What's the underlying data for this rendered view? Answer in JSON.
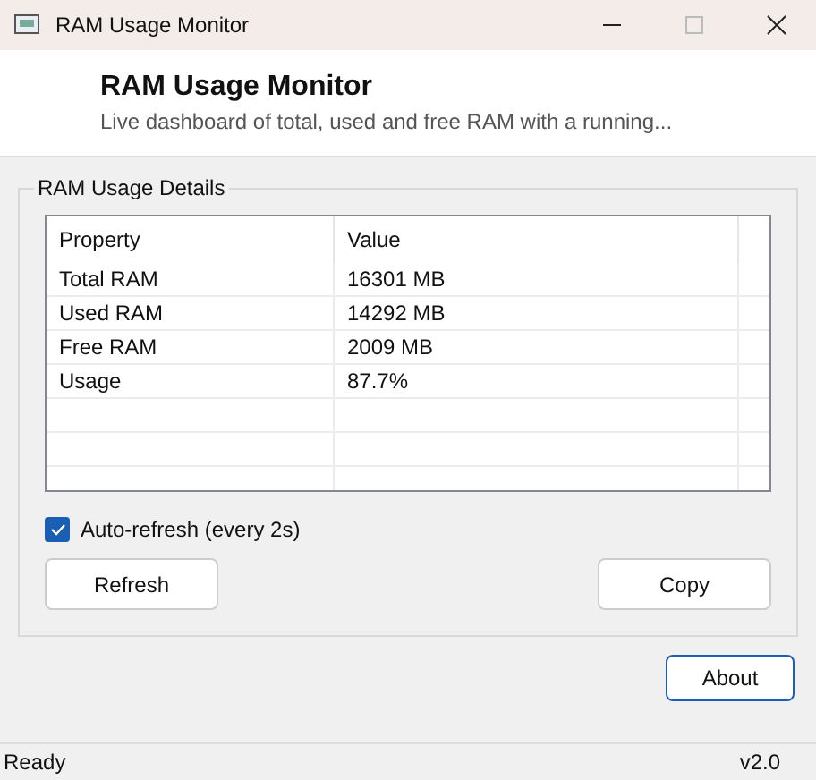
{
  "window": {
    "title": "RAM Usage Monitor"
  },
  "header": {
    "title": "RAM Usage Monitor",
    "subtitle": "Live dashboard of total, used and free RAM with a running..."
  },
  "group": {
    "title": "RAM Usage Details",
    "table": {
      "columns": [
        "Property",
        "Value"
      ],
      "rows": [
        [
          "Total RAM",
          "16301 MB"
        ],
        [
          "Used RAM",
          "14292 MB"
        ],
        [
          "Free RAM",
          "2009 MB"
        ],
        [
          "Usage",
          "87.7%"
        ]
      ]
    },
    "auto_refresh": {
      "label": "Auto-refresh (every 2s)",
      "checked": true
    },
    "buttons": [
      "Refresh",
      "Copy"
    ]
  },
  "about_button": "About",
  "status_bar": {
    "left": "Ready",
    "right": "v2.0"
  }
}
